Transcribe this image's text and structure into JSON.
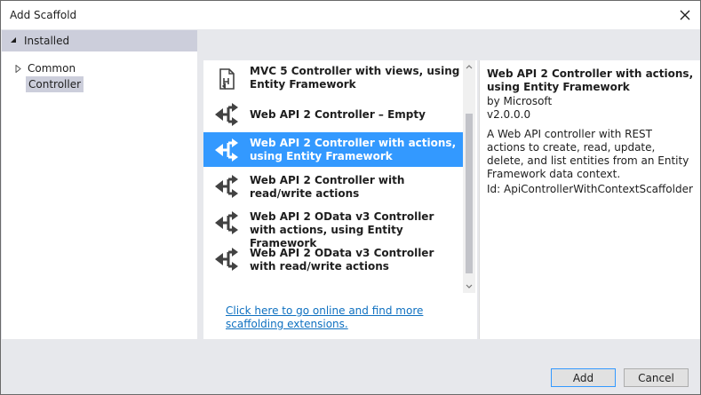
{
  "window": {
    "title": "Add Scaffold"
  },
  "tree": {
    "header": "Installed",
    "items": [
      {
        "label": "Common"
      },
      {
        "label": "Controller",
        "selected": true
      }
    ]
  },
  "list": {
    "items": [
      {
        "label": "MVC 5 Controller with views, using Entity Framework",
        "icon": "mvc-controller-icon"
      },
      {
        "label": "Web API 2 Controller – Empty",
        "icon": "api-controller-icon"
      },
      {
        "label": "Web API 2 Controller with actions, using Entity Framework",
        "icon": "api-controller-icon",
        "selected": true
      },
      {
        "label": "Web API 2 Controller with read/write actions",
        "icon": "api-controller-icon"
      },
      {
        "label": "Web API 2 OData v3 Controller with actions, using Entity Framework",
        "icon": "api-controller-icon"
      },
      {
        "label": "Web API 2 OData v3 Controller with read/write actions",
        "icon": "api-controller-icon"
      }
    ],
    "online_link": "Click here to go online and find more scaffolding extensions."
  },
  "details": {
    "title": "Web API 2 Controller with actions, using Entity Framework",
    "by": "by Microsoft",
    "version": "v2.0.0.0",
    "description": "A Web API controller with REST actions to create, read, update, delete, and list entities from an Entity Framework data context.",
    "id": "Id: ApiControllerWithContextScaffolder"
  },
  "buttons": {
    "add": "Add",
    "cancel": "Cancel"
  },
  "colors": {
    "selection": "#3399ff",
    "link": "#0e70c0",
    "tree_header": "#cccedb"
  }
}
